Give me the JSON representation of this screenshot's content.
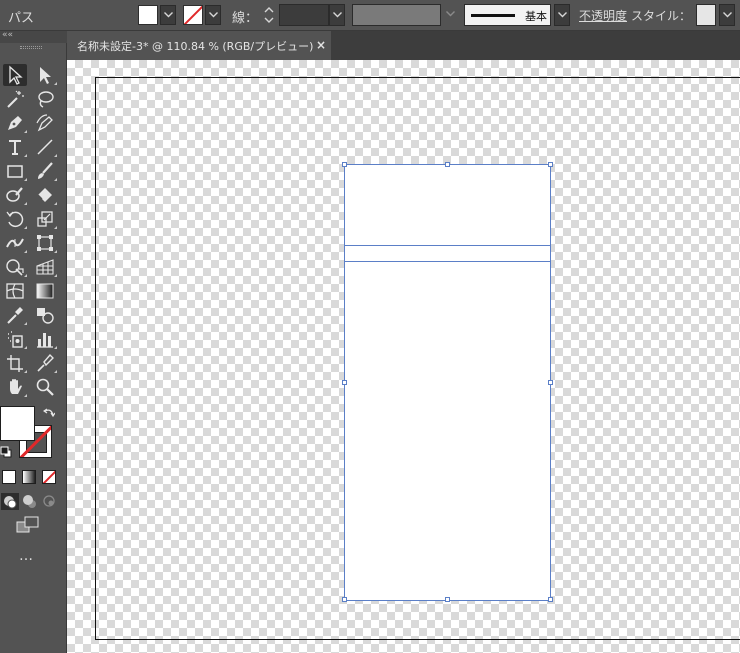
{
  "control_bar": {
    "selection_label": "パス",
    "stroke_label": "線：",
    "brush_label": "基本",
    "opacity_label": "不透明度",
    "style_label": "スタイル："
  },
  "tools_panel": {
    "collapse_glyph": "««"
  },
  "document_tab": {
    "title": "名称未設定-3* @ 110.84 % (RGB/プレビュー)",
    "close_glyph": "×"
  },
  "more_tools_glyph": "…",
  "colors": {
    "ui_panel": "#535353",
    "selection": "#5b7fc7",
    "none_slash": "#e0282a"
  },
  "icons": [
    "selection-icon",
    "direct-selection-icon",
    "magic-wand-icon",
    "lasso-icon",
    "pen-icon",
    "curvature-icon",
    "type-icon",
    "line-segment-icon",
    "rectangle-icon",
    "paintbrush-icon",
    "shaper-icon",
    "eraser-icon",
    "rotate-icon",
    "scale-icon",
    "width-icon",
    "free-transform-icon",
    "shape-builder-icon",
    "perspective-grid-icon",
    "mesh-icon",
    "gradient-icon",
    "eyedropper-icon",
    "blend-icon",
    "symbol-sprayer-icon",
    "column-graph-icon",
    "artboard-icon",
    "slice-icon",
    "hand-icon",
    "zoom-icon"
  ]
}
